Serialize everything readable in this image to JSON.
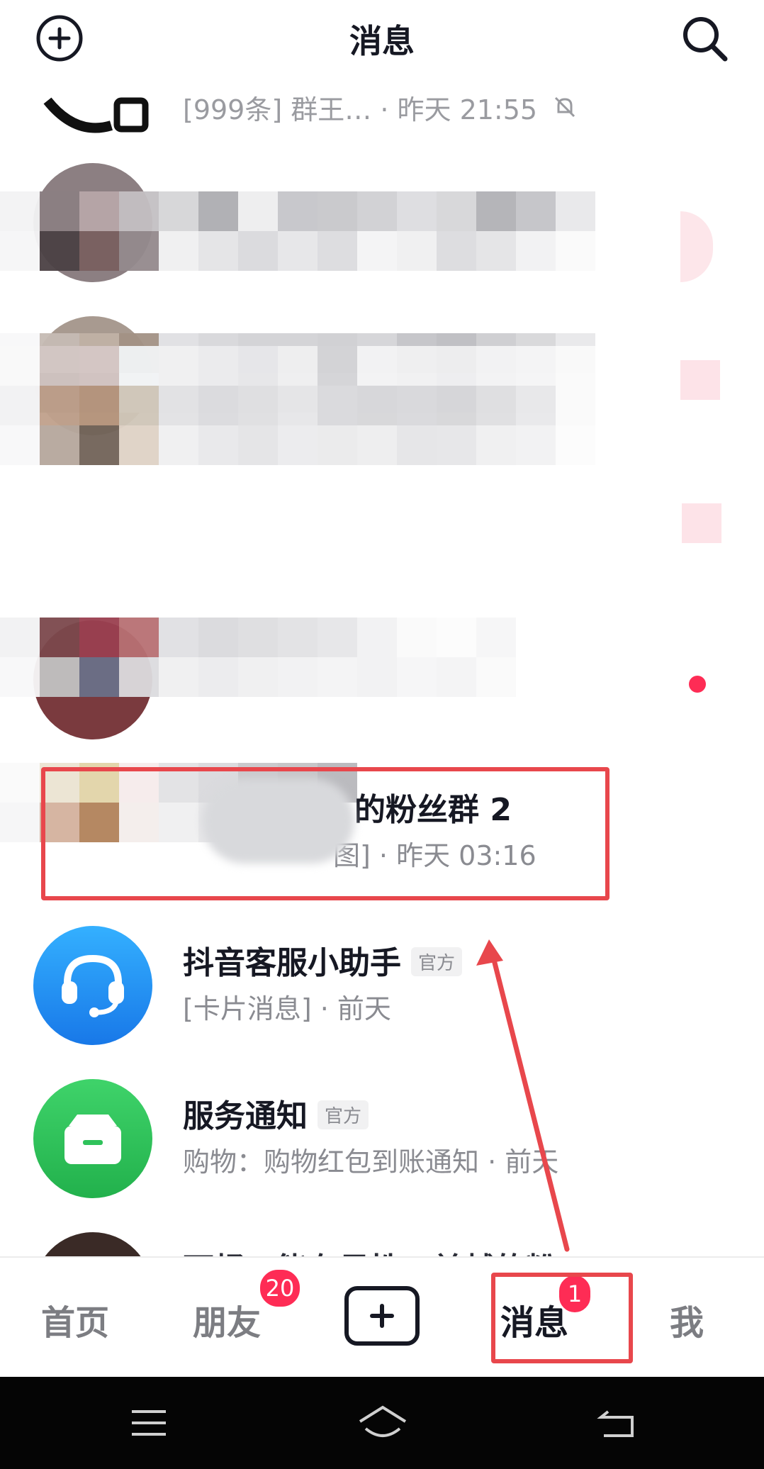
{
  "header": {
    "title": "消息",
    "add_icon": "plus-circle-icon",
    "search_icon": "search-icon"
  },
  "conversations": [
    {
      "subtitle_visible": "[999条] 群王…  · 昨天 21:55",
      "muted_icon": "bell-off-icon"
    },
    {
      "redacted": true
    },
    {
      "redacted": true
    },
    {
      "redacted": true
    },
    {
      "redacted": true,
      "unread_dot": true
    },
    {
      "title_visible": "的粉丝群 2",
      "subtitle_visible": "图] · 昨天 03:16",
      "redacted": true,
      "highlighted": true
    },
    {
      "title": "抖音客服小助手",
      "official_badge": "官方",
      "subtitle": "[卡片消息] · 前天",
      "icon": "headset-icon",
      "color": "#1e8cf2"
    },
    {
      "title": "服务通知",
      "official_badge": "官方",
      "subtitle": "购物：购物红包到账通知 · 前天",
      "icon": "inbox-icon",
      "color": "#2fc25b"
    },
    {
      "title_visible": "可畅…能在显性…兰越的粉…",
      "redacted": true
    }
  ],
  "tabbar": {
    "home": "首页",
    "friends": "朋友",
    "friends_badge": "20",
    "create_icon": "plus-square-icon",
    "messages": "消息",
    "messages_badge": "1",
    "me": "我"
  },
  "system_nav": {
    "menu_icon": "menu-icon",
    "home_icon": "home-icon",
    "back_icon": "back-icon"
  },
  "colors": {
    "accent": "#fe2c55",
    "highlight": "#e8474c",
    "text_primary": "#161823",
    "text_secondary": "#8a8b91"
  }
}
